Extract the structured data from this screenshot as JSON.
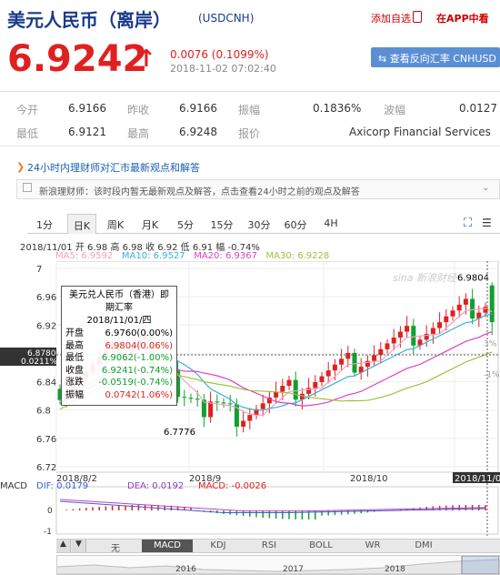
{
  "header": {
    "title": "美元人民币（离岸）",
    "code": "(USDCNH)",
    "add_favorite": "添加自选",
    "in_app": "在APP中看"
  },
  "quote": {
    "price": "6.9242",
    "arrow": "↑",
    "change": "0.0076 (0.1099%)",
    "time": "2018-11-02 07:02:40",
    "reverse_button": "⇆ 查看反向汇率 CNHUSD"
  },
  "stats": {
    "open_label": "今开",
    "open": "6.9166",
    "prev_label": "昨收",
    "prev": "6.9166",
    "amp_label": "振幅",
    "amp": "0.1836%",
    "wave_label": "波幅",
    "wave": "0.0127",
    "low_label": "最低",
    "low": "6.9121",
    "high_label": "最高",
    "high": "6.9248",
    "source_label": "报价",
    "source": "Axicorp Financial Services"
  },
  "news": {
    "heading": "24小时内理财师对汇市最新观点和解答",
    "text": "新浪理财师：该时段内暂无最新观点及解答，点击查看24小时之前的观点及解答",
    "expand": "⌄"
  },
  "tabs": [
    "1分",
    "日K",
    "周K",
    "月K",
    "5分",
    "15分",
    "30分",
    "60分",
    "4H"
  ],
  "active_tab": "日K",
  "ohlc_line": "2018/11/01  开 6.98  高 6.98  收 6.92  低 6.91  幅 -0.74%",
  "ma": {
    "ma5": "MA5: 6.9592",
    "ma10": "MA10: 6.9527",
    "ma20": "MA20: 6.9367",
    "ma30": "MA30: 6.9228",
    "c5": "#f4a0c0",
    "c10": "#3ab0d8",
    "c20": "#e040c0",
    "c30": "#a0c040"
  },
  "tooltip": {
    "title": "美元兑人民币（香港）即期汇率",
    "date": "2018/11/01/四",
    "rows": [
      {
        "label": "开盘",
        "value": "6.9760(0.00%)"
      },
      {
        "label": "最高",
        "value": "6.9804(0.06%)"
      },
      {
        "label": "最低",
        "value": "6.9062(-1.00%)"
      },
      {
        "label": "收盘",
        "value": "6.9241(-0.74%)"
      },
      {
        "label": "涨跌",
        "value": "-0.0519(-0.74%)"
      },
      {
        "label": "振幅",
        "value": "0.0742(1.06%)"
      }
    ]
  },
  "chart": {
    "y_ticks": [
      "7",
      "6.96",
      "6.92",
      "6.88",
      "6.84",
      "6.8",
      "6.76",
      "6.72"
    ],
    "x_ticks": [
      "2018/8/2",
      "2018/9",
      "2018/10",
      "2018/11/01"
    ],
    "cursor_label": "6.8780",
    "cursor_label2": "0.0211%",
    "high_mark": "6.9804",
    "low_mark": "6.7776",
    "watermark": "新浪财经",
    "right_pct": "3%",
    "right_pct2": "-1%",
    "macd_label": "MACD",
    "dif": "DIF: 0.0179",
    "dea": "DEA: 0.0192",
    "macd": "MACD: -0.0026",
    "macd_ticks": [
      "0",
      "-1"
    ],
    "up_color": "#e02020",
    "down_color": "#10a030"
  },
  "indicators": [
    "无",
    "MACD",
    "KDJ",
    "RSI",
    "BOLL",
    "WR",
    "DMI"
  ],
  "active_indicator": "MACD",
  "timeline": [
    "2016",
    "2017",
    "2018"
  ]
}
